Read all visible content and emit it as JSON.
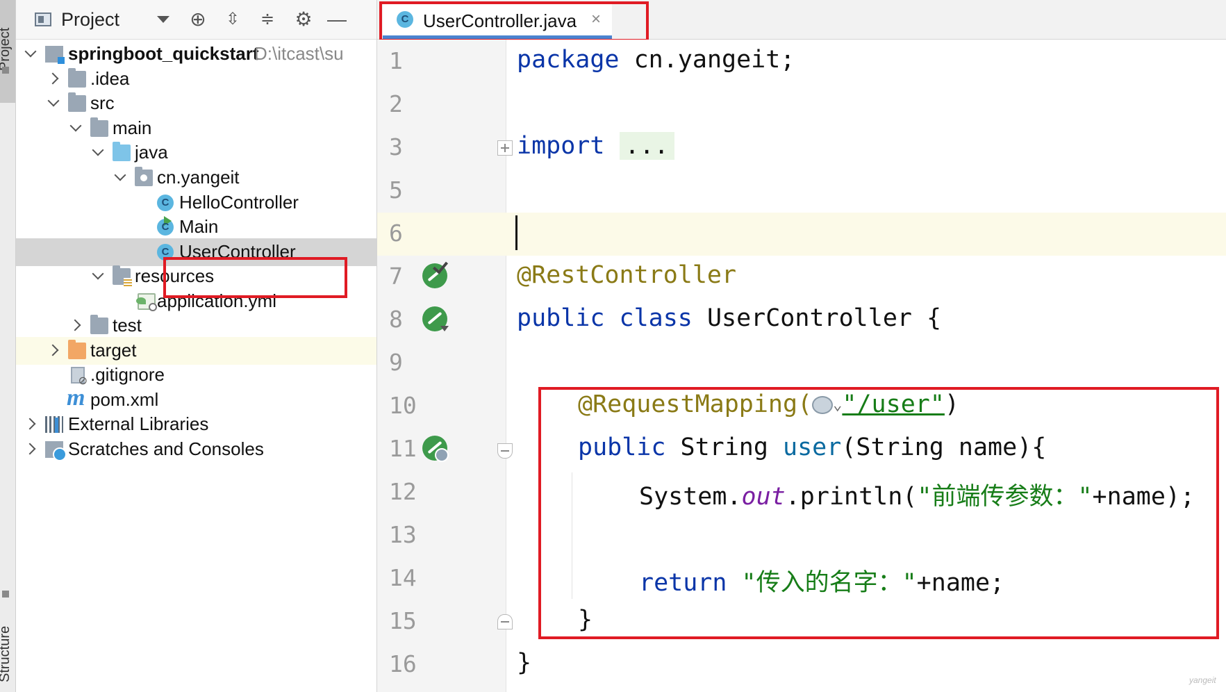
{
  "side_strip": {
    "project_label": "Project",
    "structure_label": "Structure"
  },
  "project_panel": {
    "title": "Project",
    "toolbar_icons": [
      "target-icon",
      "expand-all-icon",
      "collapse-all-icon",
      "gear-icon",
      "minimize-icon"
    ],
    "tree": [
      {
        "label": "springboot_quickstart",
        "path": "D:\\itcast\\su",
        "icon": "module-icon",
        "expanded": true
      },
      {
        "label": ".idea",
        "icon": "folder-icon",
        "expanded": false
      },
      {
        "label": "src",
        "icon": "folder-icon",
        "expanded": true
      },
      {
        "label": "main",
        "icon": "folder-icon",
        "expanded": true
      },
      {
        "label": "java",
        "icon": "source-folder-icon",
        "expanded": true
      },
      {
        "label": "cn.yangeit",
        "icon": "package-icon",
        "expanded": true
      },
      {
        "label": "HelloController",
        "icon": "class-icon"
      },
      {
        "label": "Main",
        "icon": "main-class-icon"
      },
      {
        "label": "UserController",
        "icon": "class-icon",
        "selected": true
      },
      {
        "label": "resources",
        "icon": "resources-folder-icon",
        "expanded": true
      },
      {
        "label": "application.yml",
        "icon": "spring-config-icon"
      },
      {
        "label": "test",
        "icon": "folder-icon",
        "expanded": false
      },
      {
        "label": "target",
        "icon": "excluded-folder-icon",
        "expanded": false
      },
      {
        "label": ".gitignore",
        "icon": "ignored-file-icon"
      },
      {
        "label": "pom.xml",
        "icon": "maven-icon"
      },
      {
        "label": "External Libraries",
        "icon": "libraries-icon",
        "expanded": false
      },
      {
        "label": "Scratches and Consoles",
        "icon": "scratches-icon",
        "expanded": false
      }
    ]
  },
  "editor": {
    "tab": {
      "label": "UserController.java",
      "close": "×"
    },
    "line_numbers": [
      "1",
      "2",
      "3",
      "5",
      "6",
      "7",
      "8",
      "9",
      "10",
      "11",
      "12",
      "13",
      "14",
      "15",
      "16"
    ],
    "code": {
      "l1_kw": "package",
      "l1_rest": " cn.yangeit;",
      "l3_kw": "import",
      "l3_fold": "...",
      "l7_ann": "@RestController",
      "l8_kw1": "public",
      "l8_kw2": "class",
      "l8_rest": "UserController {",
      "l10_ann": "@RequestMapping(",
      "l10_str": "\"/user\"",
      "l10_close": ")",
      "l11_kw": "public",
      "l11_type": "String",
      "l11_meth": "user",
      "l11_rest": "(String name){",
      "l12_obj": "System.",
      "l12_field": "out",
      "l12_call": ".println(",
      "l12_str": "\"前端传参数：\"",
      "l12_rest": "+name);",
      "l14_kw": "return",
      "l14_str": "\"传入的名字：\"",
      "l14_rest": "+name;",
      "l15": "}",
      "l16": "}"
    }
  },
  "watermark": "yangeit",
  "colors": {
    "keyword": "#0a35a8",
    "annotation": "#8a7a16",
    "string": "#177d18",
    "highlight_box": "#e01b24",
    "tab_underline": "#4b83cf"
  }
}
